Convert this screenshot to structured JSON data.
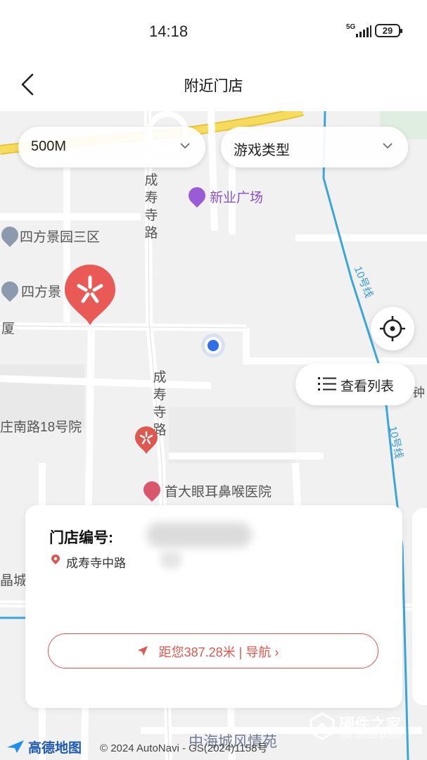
{
  "status": {
    "time": "14:18",
    "network": "5G",
    "battery": "29"
  },
  "header": {
    "title": "附近门店"
  },
  "filters": {
    "distance": "500M",
    "game_type": "游戏类型"
  },
  "map": {
    "labels": {
      "xinye": "新业广场",
      "sifang3": "四方景园三区",
      "sifang": "四方景",
      "sha": "厦",
      "chengshousi1": "成寿寺路",
      "chengshousi2": "成寿寺路",
      "zhuangnan": "庄南路18号院",
      "hospital": "首大眼耳鼻喉医院",
      "jingcheng": "晶城",
      "zhonghai": "中海城风情苑",
      "fenzhong": "分钟",
      "line10a": "10号线",
      "line10b": "10号线"
    }
  },
  "buttons": {
    "list_view": "查看列表"
  },
  "card": {
    "store_id_label": "门店编号:",
    "address": "成寿寺中路",
    "nav": "距您387.28米 | 导航 ›"
  },
  "footer": {
    "logo": "高德地图",
    "copyright": "© 2024 AutoNavi - GS(2024)1158号"
  },
  "watermark": {
    "name": "硬件之家",
    "url": "YING JIAN ZHI JIA.COM"
  },
  "colors": {
    "accent": "#e0574f",
    "location_dot": "#2f6ee6",
    "metro": "#3aa7d8",
    "road_yellow": "#f5d24a"
  }
}
